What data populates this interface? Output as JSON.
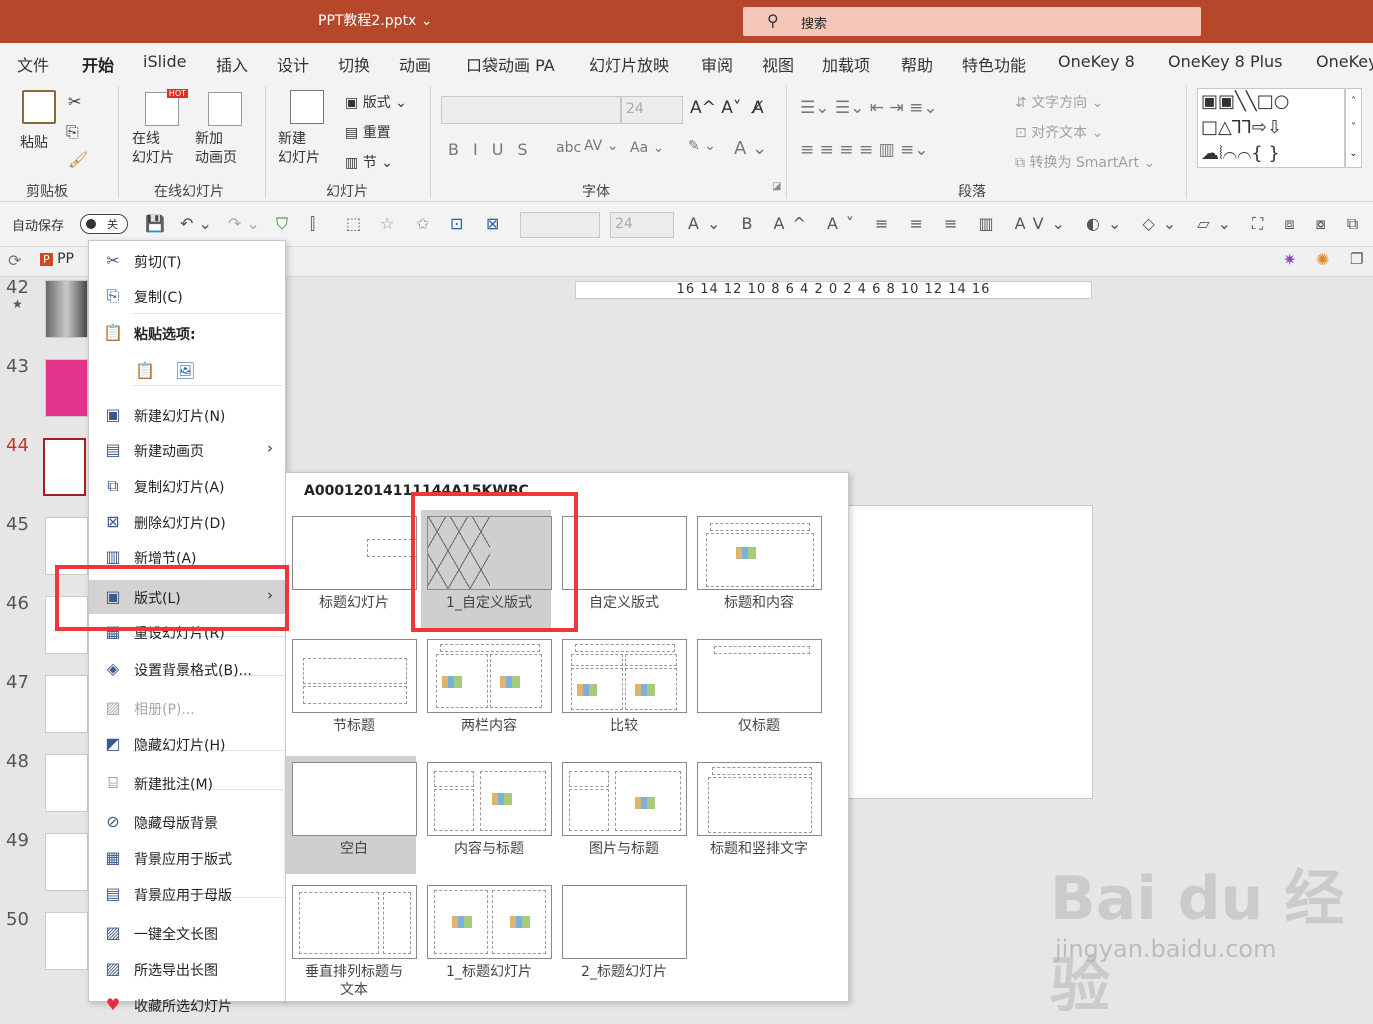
{
  "title": {
    "file": "PPT教程2.pptx",
    "caret": "⌄",
    "search_placeholder": "搜索"
  },
  "tabs": [
    "文件",
    "开始",
    "iSlide",
    "插入",
    "设计",
    "切换",
    "动画",
    "口袋动画 PA",
    "幻灯片放映",
    "审阅",
    "视图",
    "加载项",
    "帮助",
    "特色功能",
    "OneKey 8",
    "OneKey 8 Plus",
    "OneKey"
  ],
  "active_tab": "开始",
  "ribbon": {
    "clipboard": {
      "paste": "粘贴",
      "group": "剪贴板"
    },
    "online": {
      "online_slide": "在线\n幻灯片",
      "new_anim": "新加\n动画页",
      "group": "在线幻灯片",
      "hot": "HOT"
    },
    "slides": {
      "new_slide": "新建\n幻灯片",
      "layout": "版式",
      "reset": "重置",
      "section": "节",
      "group": "幻灯片"
    },
    "font": {
      "size": "24",
      "group": "字体",
      "buttons": [
        "B",
        "I",
        "U",
        "S",
        "abc",
        "AV",
        "Aa",
        "A"
      ]
    },
    "paragraph": {
      "text_dir": "文字方向",
      "align_text": "对齐文本",
      "smartart": "转换为 SmartArt",
      "group": "段落"
    }
  },
  "qat": {
    "autosave": "自动保存",
    "toggle": "关",
    "font_size": "24"
  },
  "thumbnails": [
    {
      "num": "42",
      "star": "★"
    },
    {
      "num": "43"
    },
    {
      "num": "44",
      "selected": true
    },
    {
      "num": "45"
    },
    {
      "num": "46"
    },
    {
      "num": "47"
    },
    {
      "num": "48"
    },
    {
      "num": "49"
    },
    {
      "num": "50"
    }
  ],
  "tab_file": "PP",
  "ruler": "16 14 12 10 8 6 4 2 0 2 4 6 8 10 12 14 16",
  "context_menu": [
    {
      "label": "剪切(T)",
      "icon": "scissors-icon"
    },
    {
      "label": "复制(C)",
      "icon": "copy-icon"
    },
    {
      "label": "粘贴选项:",
      "icon": "paste-icon",
      "bold": true
    },
    {
      "label": "",
      "icon": "paste-options-icon"
    },
    {
      "label": "新建幻灯片(N)",
      "icon": "new-slide-icon"
    },
    {
      "label": "新建动画页",
      "icon": "new-anim-icon",
      "submenu": true
    },
    {
      "label": "复制幻灯片(A)",
      "icon": "duplicate-slide-icon"
    },
    {
      "label": "删除幻灯片(D)",
      "icon": "delete-slide-icon"
    },
    {
      "label": "新增节(A)",
      "icon": "add-section-icon"
    },
    {
      "label": "版式(L)",
      "icon": "layout-icon",
      "submenu": true,
      "highlight": true
    },
    {
      "label": "重设幻灯片(R)",
      "icon": "reset-slide-icon"
    },
    {
      "label": "设置背景格式(B)...",
      "icon": "format-bg-icon"
    },
    {
      "label": "相册(P)...",
      "icon": "album-icon",
      "disabled": true
    },
    {
      "label": "隐藏幻灯片(H)",
      "icon": "hide-slide-icon"
    },
    {
      "label": "新建批注(M)",
      "icon": "new-comment-icon"
    },
    {
      "label": "隐藏母版背景",
      "icon": "hide-master-bg-icon"
    },
    {
      "label": "背景应用于版式",
      "icon": "bg-to-layout-icon"
    },
    {
      "label": "背景应用于母版",
      "icon": "bg-to-master-icon"
    },
    {
      "label": "一键全文长图",
      "icon": "long-image-icon"
    },
    {
      "label": "所选导出长图",
      "icon": "export-long-image-icon"
    },
    {
      "label": "收藏所选幻灯片",
      "icon": "heart-icon"
    }
  ],
  "submenu": {
    "title": "A00012014111144A15KWBC",
    "layouts": [
      {
        "name": "标题幻灯片"
      },
      {
        "name": "1_自定义版式",
        "selected": true
      },
      {
        "name": "自定义版式"
      },
      {
        "name": "标题和内容"
      },
      {
        "name": "节标题"
      },
      {
        "name": "两栏内容"
      },
      {
        "name": "比较"
      },
      {
        "name": "仅标题"
      },
      {
        "name": "空白",
        "selected": true
      },
      {
        "name": "内容与标题"
      },
      {
        "name": "图片与标题"
      },
      {
        "name": "标题和竖排文字"
      },
      {
        "name": "垂直排列标题与\n文本"
      },
      {
        "name": "1_标题幻灯片"
      },
      {
        "name": "2_标题幻灯片"
      }
    ]
  },
  "watermark": {
    "brand": "Bai du 经验",
    "url": "jingyan.baidu.com"
  },
  "colors": {
    "accent": "#b7472a",
    "highlight": "#f0353d"
  }
}
